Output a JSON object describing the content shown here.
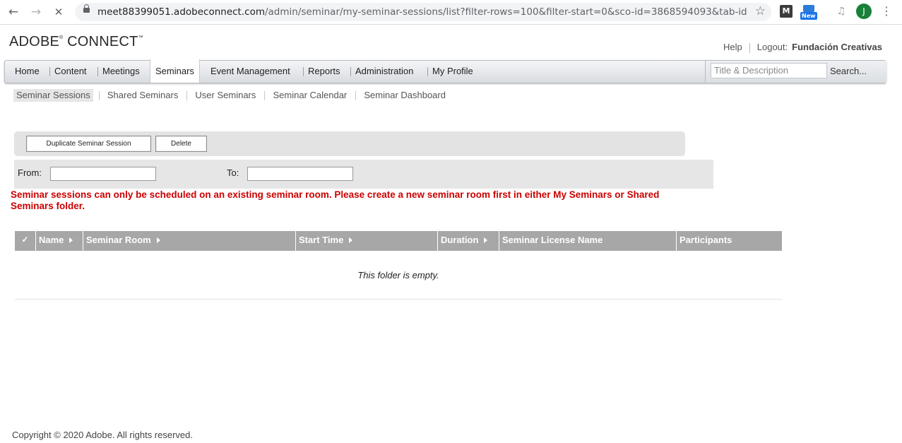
{
  "browser": {
    "url_host": "meet88399051.adobeconnect.com",
    "url_path": "/admin/seminar/my-seminar-sessions/list?filter-rows=100&filter-start=0&sco-id=3868594093&tab-id=386859...",
    "back_glyph": "←",
    "forward_glyph": "→",
    "stop_glyph": "✕",
    "bookmark_glyph": "☆",
    "ext_m_label": "M",
    "ext_new_label": "New",
    "music_glyph": "♫",
    "profile_initial": "J",
    "menu_glyph": "⋮"
  },
  "header": {
    "logo_adobe": "ADOBE",
    "logo_reg": "®",
    "logo_connect": "CONNECT",
    "logo_tm": "™",
    "help": "Help",
    "logout_label": "Logout:",
    "user_name": "Fundación Creativas"
  },
  "mainnav": {
    "items": [
      "Home",
      "Content",
      "Meetings",
      "Seminars",
      "Event Management",
      "Reports",
      "Administration",
      "My Profile"
    ],
    "active": "Seminars",
    "search_placeholder": "Title & Description",
    "search_button": "Search..."
  },
  "subnav": {
    "items": [
      "Seminar Sessions",
      "Shared Seminars",
      "User Seminars",
      "Seminar Calendar",
      "Seminar Dashboard"
    ],
    "active": "Seminar Sessions"
  },
  "toolbar": {
    "duplicate_label": "Duplicate Seminar Session",
    "delete_label": "Delete"
  },
  "filter": {
    "from_label": "From:",
    "to_label": "To:",
    "from_value": "",
    "to_value": ""
  },
  "message": "Seminar sessions can only be scheduled on an existing seminar room. Please create a new seminar room first in either My Seminars or Shared Seminars folder.",
  "table": {
    "check_glyph": "✓",
    "columns": [
      "Name",
      "Seminar Room",
      "Start Time",
      "Duration",
      "Seminar License Name",
      "Participants"
    ],
    "empty_text": "This folder is empty."
  },
  "footer": {
    "copyright": "Copyright © 2020 Adobe. All rights reserved."
  },
  "colors": {
    "error": "#cc0000",
    "header_bg": "#a7a7a7",
    "profile_avatar": "#188038"
  }
}
